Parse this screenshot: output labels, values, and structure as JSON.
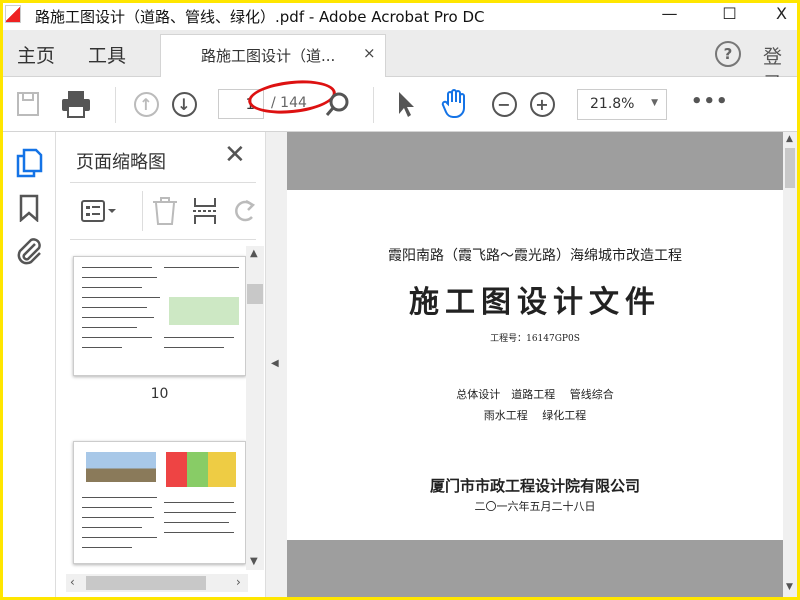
{
  "window": {
    "title": "路施工图设计（道路、管线、绿化）.pdf - Adobe Acrobat Pro DC",
    "minimize": "—",
    "maximize": "☐",
    "close": "X"
  },
  "nav": {
    "home": "主页",
    "tools": "工具",
    "doc_tab": "路施工图设计（道...",
    "tab_close": "×",
    "help": "?",
    "login": "登录"
  },
  "toolbar": {
    "current_page": "1",
    "page_count": "/ 144",
    "zoom": "21.8%",
    "more": "•••"
  },
  "panel": {
    "title": "页面缩略图",
    "close": "✕",
    "thumbnails": [
      {
        "label": "10"
      },
      {
        "label": ""
      }
    ]
  },
  "document": {
    "subtitle": "霞阳南路（霞飞路～霞光路）海绵城市改造工程",
    "title": "施工图设计文件",
    "project_no": "工程号：16147GP0S",
    "contents_line1": "总体设计　道路工程　 管线综合",
    "contents_line2": "雨水工程　 绿化工程",
    "company": "厦门市市政工程设计院有限公司",
    "date": "二〇一六年五月二十八日"
  },
  "colors": {
    "accent": "#1473e6",
    "annotation": "#dd1111",
    "frame": "#ffe600"
  }
}
